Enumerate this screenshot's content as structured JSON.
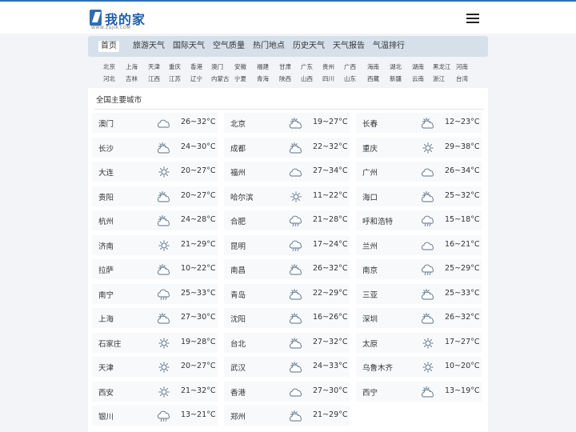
{
  "site": {
    "name": "我的家",
    "domain": "WWW.ZGJIA.COM"
  },
  "nav": [
    "首页",
    "旅游天气",
    "国际天气",
    "空气质量",
    "热门地点",
    "历史天气",
    "天气报告",
    "气温排行"
  ],
  "regions": [
    [
      "北京",
      "上海",
      "天津",
      "重庆",
      "香港",
      "澳门",
      "安徽",
      "福建",
      "甘肃",
      "广东",
      "贵州",
      "广西",
      "海南",
      "湖北",
      "湖南",
      "黑龙江",
      "河南"
    ],
    [
      "河北",
      "吉林",
      "江西",
      "江苏",
      "辽宁",
      "内蒙古",
      "宁夏",
      "青海",
      "陕西",
      "山西",
      "四川",
      "山东",
      "西藏",
      "新疆",
      "云南",
      "浙江",
      "台湾"
    ]
  ],
  "section_title": "全国主要城市",
  "cities": [
    {
      "name": "澳门",
      "icon": "cloudy-icon",
      "temp": "26~32°C"
    },
    {
      "name": "北京",
      "icon": "partly-cloudy-icon",
      "temp": "19~27°C"
    },
    {
      "name": "长春",
      "icon": "partly-cloudy-icon",
      "temp": "12~23°C"
    },
    {
      "name": "长沙",
      "icon": "partly-cloudy-icon",
      "temp": "24~30°C"
    },
    {
      "name": "成都",
      "icon": "partly-cloudy-icon",
      "temp": "22~32°C"
    },
    {
      "name": "重庆",
      "icon": "sunny-icon",
      "temp": "29~38°C"
    },
    {
      "name": "大连",
      "icon": "sunny-icon",
      "temp": "20~27°C"
    },
    {
      "name": "福州",
      "icon": "cloudy-icon",
      "temp": "27~34°C"
    },
    {
      "name": "广州",
      "icon": "cloudy-icon",
      "temp": "26~34°C"
    },
    {
      "name": "贵阳",
      "icon": "partly-cloudy-icon",
      "temp": "20~27°C"
    },
    {
      "name": "哈尔滨",
      "icon": "sunny-icon",
      "temp": "11~22°C"
    },
    {
      "name": "海口",
      "icon": "partly-cloudy-icon",
      "temp": "25~32°C"
    },
    {
      "name": "杭州",
      "icon": "partly-cloudy-icon",
      "temp": "24~28°C"
    },
    {
      "name": "合肥",
      "icon": "rain-icon",
      "temp": "21~28°C"
    },
    {
      "name": "呼和浩特",
      "icon": "rain-icon",
      "temp": "15~18°C"
    },
    {
      "name": "济南",
      "icon": "sunny-icon",
      "temp": "21~29°C"
    },
    {
      "name": "昆明",
      "icon": "rain-icon",
      "temp": "17~24°C"
    },
    {
      "name": "兰州",
      "icon": "cloudy-icon",
      "temp": "16~21°C"
    },
    {
      "name": "拉萨",
      "icon": "partly-cloudy-icon",
      "temp": "10~22°C"
    },
    {
      "name": "南昌",
      "icon": "partly-cloudy-icon",
      "temp": "26~32°C"
    },
    {
      "name": "南京",
      "icon": "rain-icon",
      "temp": "25~29°C"
    },
    {
      "name": "南宁",
      "icon": "rain-icon",
      "temp": "25~33°C"
    },
    {
      "name": "青岛",
      "icon": "partly-cloudy-icon",
      "temp": "22~29°C"
    },
    {
      "name": "三亚",
      "icon": "partly-cloudy-icon",
      "temp": "25~33°C"
    },
    {
      "name": "上海",
      "icon": "partly-cloudy-icon",
      "temp": "27~30°C"
    },
    {
      "name": "沈阳",
      "icon": "partly-cloudy-icon",
      "temp": "16~26°C"
    },
    {
      "name": "深圳",
      "icon": "partly-cloudy-icon",
      "temp": "26~32°C"
    },
    {
      "name": "石家庄",
      "icon": "sunny-icon",
      "temp": "19~28°C"
    },
    {
      "name": "台北",
      "icon": "partly-cloudy-icon",
      "temp": "27~32°C"
    },
    {
      "name": "太原",
      "icon": "sunny-icon",
      "temp": "17~27°C"
    },
    {
      "name": "天津",
      "icon": "sunny-icon",
      "temp": "20~27°C"
    },
    {
      "name": "武汉",
      "icon": "partly-cloudy-icon",
      "temp": "24~33°C"
    },
    {
      "name": "乌鲁木齐",
      "icon": "sunny-icon",
      "temp": "10~20°C"
    },
    {
      "name": "西安",
      "icon": "sunny-icon",
      "temp": "21~32°C"
    },
    {
      "name": "香港",
      "icon": "cloudy-icon",
      "temp": "27~30°C"
    },
    {
      "name": "西宁",
      "icon": "partly-cloudy-icon",
      "temp": "13~19°C"
    },
    {
      "name": "银川",
      "icon": "rain-icon",
      "temp": "13~21°C"
    },
    {
      "name": "郑州",
      "icon": "partly-cloudy-icon",
      "temp": "21~29°C"
    }
  ]
}
